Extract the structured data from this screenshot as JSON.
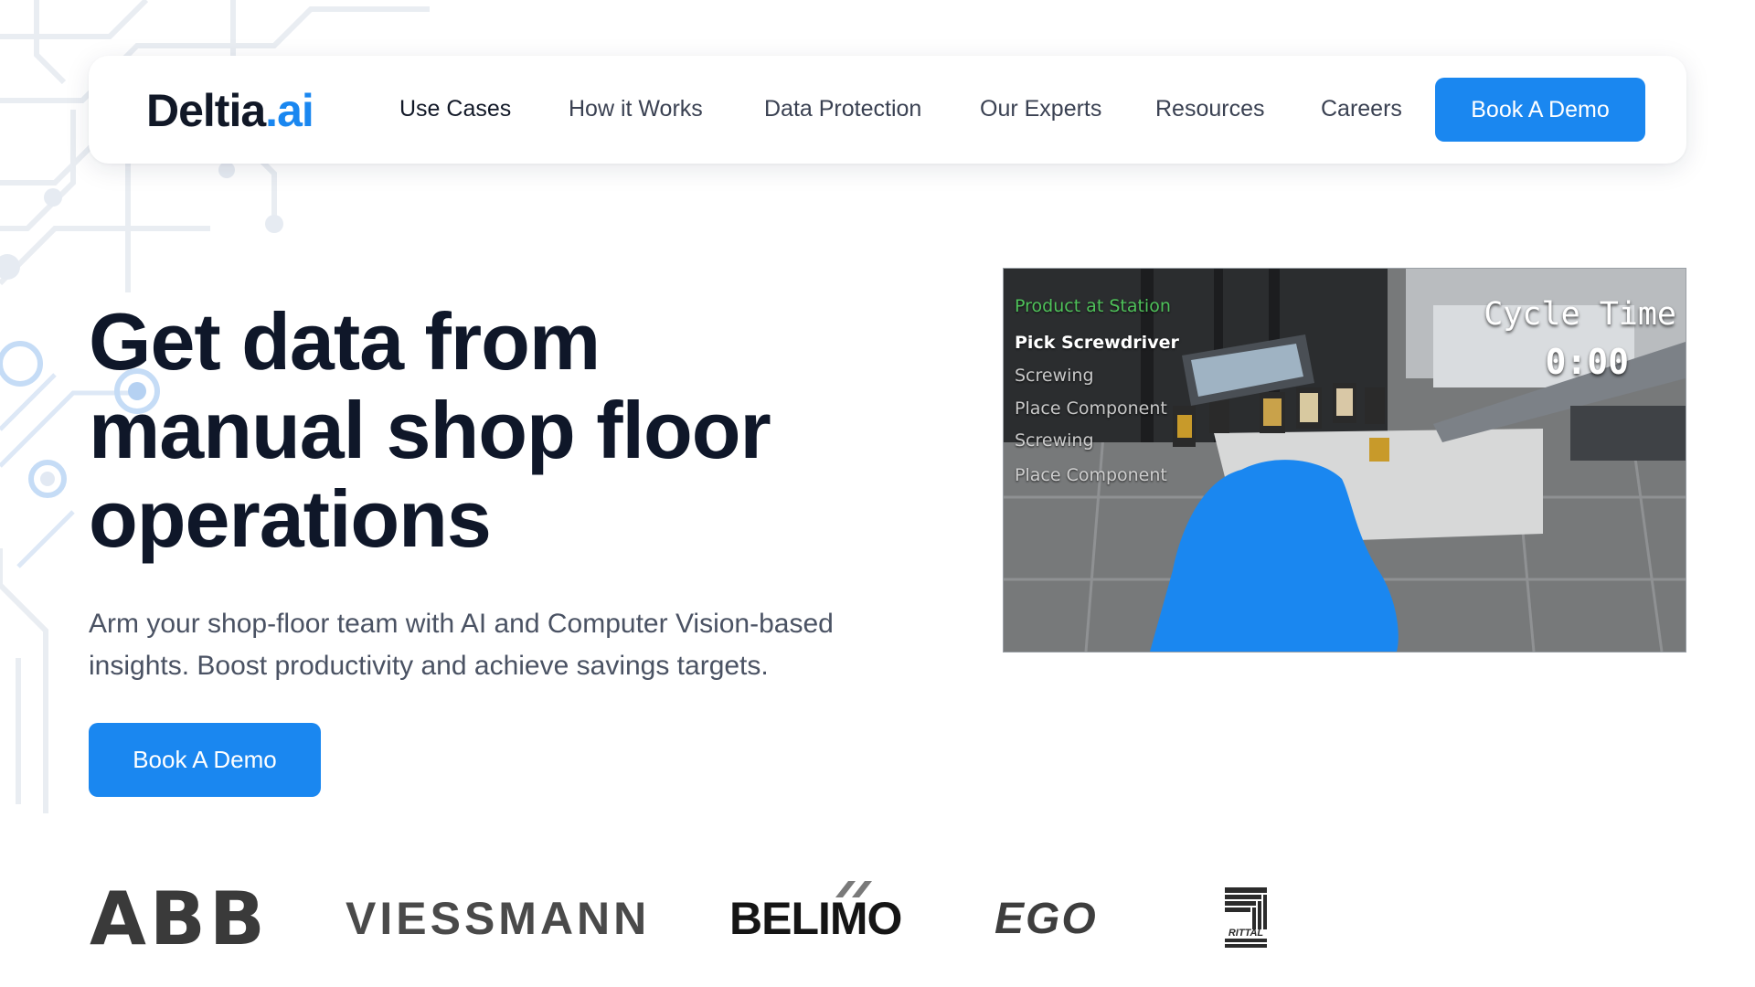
{
  "logo": {
    "name": "Deltia",
    "suffix": ".ai"
  },
  "nav": {
    "items": [
      {
        "label": "Use Cases"
      },
      {
        "label": "How it Works"
      },
      {
        "label": "Data Protection"
      },
      {
        "label": "Our Experts"
      },
      {
        "label": "Resources"
      },
      {
        "label": "Careers"
      }
    ],
    "cta_label": "Book A Demo"
  },
  "hero": {
    "title_lines": [
      "Get data from",
      "manual shop floor",
      "operations"
    ],
    "subtitle_lines": [
      "Arm your shop-floor team with AI and Computer Vision-based",
      "insights. Boost productivity and achieve savings targets."
    ],
    "cta_label": "Book A Demo"
  },
  "video": {
    "header": "Product at Station",
    "tasks": [
      {
        "label": "Pick Screwdriver",
        "state": "current"
      },
      {
        "label": "Screwing",
        "state": "pending"
      },
      {
        "label": "Place Component",
        "state": "pending"
      },
      {
        "label": "Screwing",
        "state": "pending"
      },
      {
        "label": "Place Component",
        "state": "pending"
      }
    ],
    "cycle_label": "Cycle Time",
    "cycle_value": "0:00",
    "highlight_color": "#1a87f0"
  },
  "customers": {
    "brands": [
      "ABB",
      "VIESSMANN",
      "BELIMO",
      "EGO",
      "RITTAL"
    ]
  },
  "colors": {
    "brand_blue": "#1a87f0",
    "heading": "#0f1729",
    "body_text": "#4a5263"
  },
  "icons": [
    "circuit-background-decoration"
  ]
}
